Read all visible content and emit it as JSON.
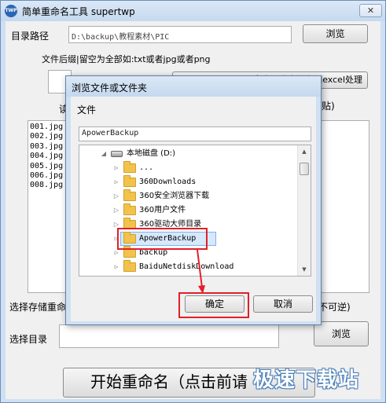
{
  "window": {
    "icon_text": "TWP",
    "title": "简单重命名工具 supertwp",
    "close_glyph": "✕"
  },
  "main": {
    "dir_label": "目录路径",
    "dir_value": "D:\\backup\\教程素材\\PIC",
    "browse_label": "浏览",
    "suffix_hint": "文件后缀|留空为全部如:txt或者jpg或者png",
    "export_label": "点击导出文件名到excel处理",
    "partial_left": "读",
    "partial_right": "贴)",
    "files": [
      "001.jpg",
      "002.jpg",
      "003.jpg",
      "004.jpg",
      "005.jpg",
      "006.jpg",
      "008.jpg"
    ],
    "save_label_partial": "选择存储重命",
    "irreversible_partial": "不可逆)",
    "select_dir_label": "选择目录",
    "browse2_label": "浏览",
    "start_label": "开始重命名（点击前请"
  },
  "dialog": {
    "title": "浏览文件或文件夹",
    "folder_label": "文件",
    "folder_value": "ApowerBackup",
    "tree": [
      {
        "label": "本地磁盘  (D:)",
        "kind": "drive",
        "expanded": true
      },
      {
        "label": "...",
        "kind": "folder"
      },
      {
        "label": "360Downloads",
        "kind": "folder"
      },
      {
        "label": "360安全浏览器下载",
        "kind": "folder"
      },
      {
        "label": "360用户文件",
        "kind": "folder"
      },
      {
        "label": "360驱动大师目录",
        "kind": "folder"
      },
      {
        "label": "ApowerBackup",
        "kind": "folder",
        "selected": true
      },
      {
        "label": "backup",
        "kind": "folder"
      },
      {
        "label": "BaiduNetdiskDownload",
        "kind": "folder"
      }
    ],
    "ok_label": "确定",
    "cancel_label": "取消"
  },
  "watermark": "极速下载站",
  "colors": {
    "highlight": "#e0202a",
    "selection": "#d6e8fa",
    "titlebar": "#c5d9ef"
  }
}
